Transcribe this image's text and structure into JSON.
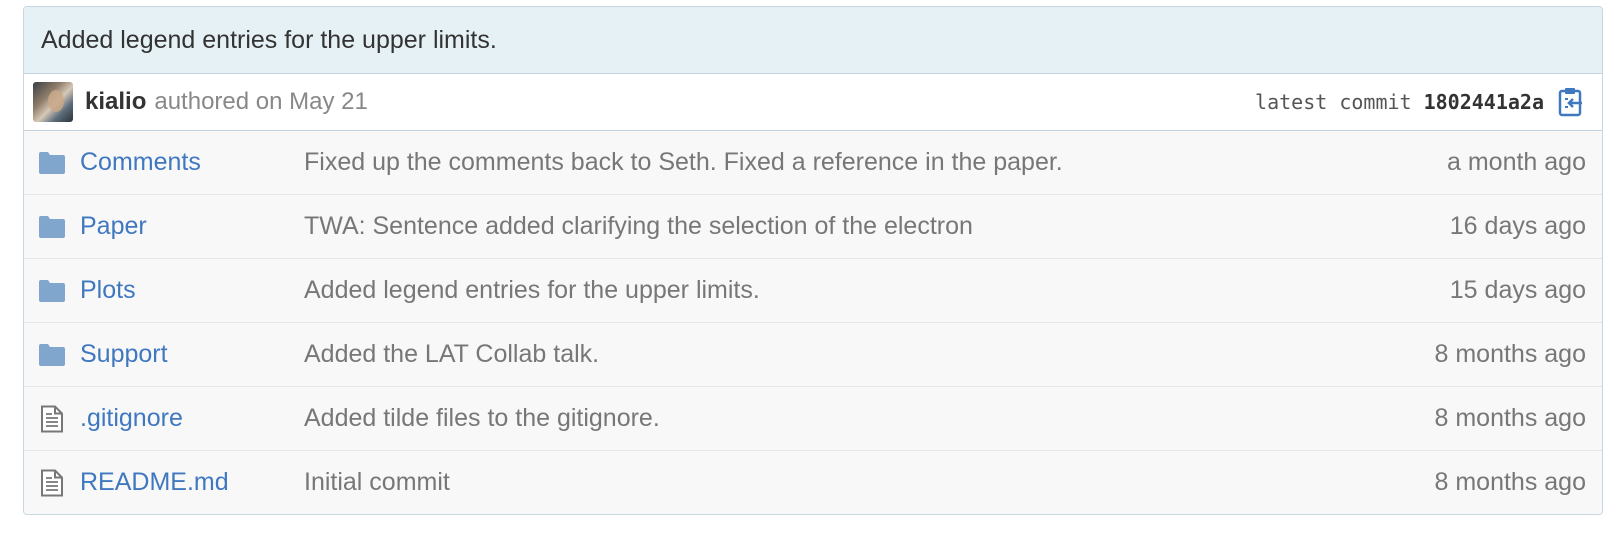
{
  "commit": {
    "message": "Added legend entries for the upper limits.",
    "author": "kialio",
    "authored_text": "authored on May 21",
    "latest_label": "latest commit",
    "sha": "1802441a2a",
    "copy_icon": "clipboard-icon"
  },
  "colors": {
    "link": "#4078c0",
    "muted": "#777777",
    "folder": "#80a6cd",
    "header_bg": "#e6f1f6"
  },
  "files": [
    {
      "icon": "folder-icon",
      "name": "Comments",
      "message": "Fixed up the comments back to Seth. Fixed a reference in the paper.",
      "age": "a month ago"
    },
    {
      "icon": "folder-icon",
      "name": "Paper",
      "message": "TWA: Sentence added clarifying the selection of the electron",
      "age": "16 days ago"
    },
    {
      "icon": "folder-icon",
      "name": "Plots",
      "message": "Added legend entries for the upper limits.",
      "age": "15 days ago"
    },
    {
      "icon": "folder-icon",
      "name": "Support",
      "message": "Added the LAT Collab talk.",
      "age": "8 months ago"
    },
    {
      "icon": "file-icon",
      "name": ".gitignore",
      "message": "Added tilde files to the gitignore.",
      "age": "8 months ago"
    },
    {
      "icon": "file-icon",
      "name": "README.md",
      "message": "Initial commit",
      "age": "8 months ago"
    }
  ]
}
